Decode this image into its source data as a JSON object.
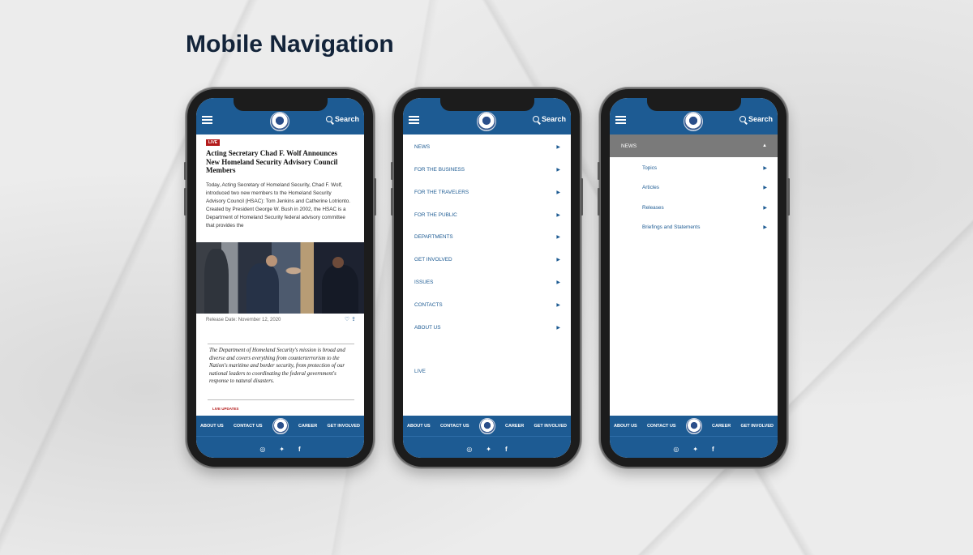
{
  "page": {
    "title": "Mobile Navigation"
  },
  "common": {
    "search_label": "Search",
    "footer": {
      "about": "ABOUT US",
      "contact": "CONTACT US",
      "career": "CAREER",
      "get_involved": "GET INVOLVED"
    },
    "social_icons": [
      "instagram-icon",
      "twitter-icon",
      "facebook-icon"
    ]
  },
  "phone1": {
    "live_badge": "LIVE",
    "headline": "Acting Secretary Chad F. Wolf Announces New Homeland Security Advisory Council Members",
    "body": "Today, Acting Secretary of Homeland Security, Chad F. Wolf, introduced two new members to the Homeland Security Advisory Council (HSAC): Tom Jenkins and Catherine Lotrionto. Created by President George W. Bush in 2002, the HSAC is a Department of Homeland Security federal advisory committee that provides the",
    "release_date": "Release Date: November 12, 2020",
    "quote": "The Department of Homeland Security's mission is broad and diverse and covers everything from counterterrorism to the Nation's maritime and border security, from protection of our national leaders to coordinating the federal government's response to natural disasters.",
    "live_updates": "LIVE UPDATES"
  },
  "phone2": {
    "menu": [
      "NEWS",
      "FOR THE BUSINESS",
      "FOR THE TRAVELERS",
      "FOR THE PUBLIC",
      "DEPARTMENTS",
      "GET INVOLVED",
      "ISSUES",
      "CONTACTS",
      "ABOUT US"
    ],
    "live": "LIVE"
  },
  "phone3": {
    "expanded": "NEWS",
    "submenu": [
      "Topics",
      "Articles",
      "Releases",
      "Briefings and Statements"
    ]
  },
  "colors": {
    "brand_blue": "#1d5b93",
    "live_red": "#b31b1b",
    "expanded_gray": "#7a7a7a"
  }
}
